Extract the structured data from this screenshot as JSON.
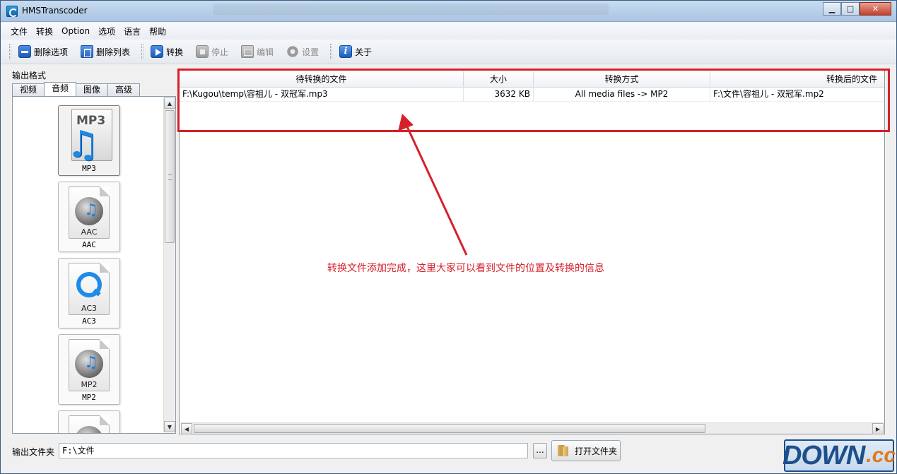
{
  "window": {
    "title": "HMSTranscoder",
    "buttons": {
      "minimize": "▁",
      "maximize": "□",
      "close": "✕"
    }
  },
  "menubar": [
    "文件",
    "转换",
    "Option",
    "选项",
    "语言",
    "帮助"
  ],
  "toolbar": {
    "delete_item": "删除选项",
    "delete_list": "删除列表",
    "convert": "转换",
    "stop": "停止",
    "edit": "编辑",
    "settings": "设置",
    "about": "关于"
  },
  "left_panel": {
    "label": "输出格式",
    "tabs": [
      "视频",
      "音频",
      "图像",
      "高级"
    ],
    "active_tab": "音频",
    "formats": [
      {
        "name": "MP3",
        "icon": "mp3-music-icon"
      },
      {
        "name": "AAC",
        "icon": "aac-disc-icon"
      },
      {
        "name": "AC3",
        "icon": "ac3-quicktime-icon"
      },
      {
        "name": "MP2",
        "icon": "mp2-disc-icon"
      }
    ]
  },
  "file_table": {
    "columns": [
      "待转换的文件",
      "大小",
      "转换方式",
      "转换后的文件"
    ],
    "rows": [
      {
        "source": "F:\\Kugou\\temp\\容祖儿 - 双冠军.mp3",
        "size": "3632 KB",
        "method": "All media files -> MP2",
        "target": "F:\\文件\\容祖儿 - 双冠军.mp2"
      }
    ]
  },
  "annotation": "转换文件添加完成，这里大家可以看到文件的位置及转换的信息",
  "bottom": {
    "output_folder_label": "输出文件夹",
    "output_folder_value": "F:\\文件",
    "browse_label": "...",
    "open_folder_label": "打开文件夹"
  },
  "watermark": {
    "down": "DOWN",
    "cc": ".cc"
  },
  "colors": {
    "annotation_red": "#d6202a",
    "watermark_blue": "#1d4f8c",
    "watermark_orange": "#e07a1a"
  }
}
